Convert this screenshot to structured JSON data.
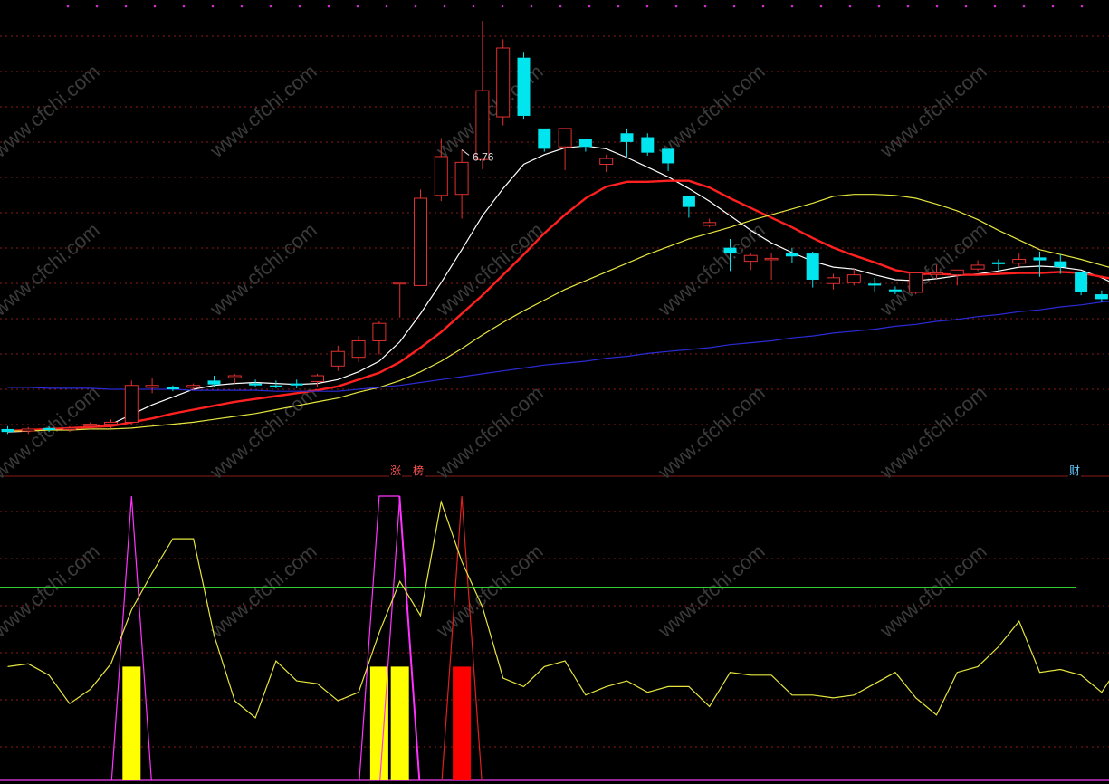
{
  "chart_data": [
    {
      "type": "candlestick",
      "title": "",
      "annotations": [
        {
          "text": "6.76",
          "bar": 22
        }
      ],
      "ylim": [
        2.4,
        6.9
      ],
      "candles": [
        [
          2.55,
          2.58,
          2.5,
          2.52
        ],
        [
          2.53,
          2.57,
          2.5,
          2.55
        ],
        [
          2.56,
          2.58,
          2.52,
          2.54
        ],
        [
          2.55,
          2.58,
          2.52,
          2.56
        ],
        [
          2.58,
          2.62,
          2.55,
          2.6
        ],
        [
          2.6,
          2.65,
          2.56,
          2.62
        ],
        [
          2.62,
          3.05,
          2.6,
          3.0
        ],
        [
          2.98,
          3.08,
          2.92,
          3.0
        ],
        [
          2.98,
          3.0,
          2.94,
          2.96
        ],
        [
          2.98,
          3.02,
          2.95,
          3.0
        ],
        [
          3.05,
          3.1,
          2.98,
          3.01
        ],
        [
          3.08,
          3.12,
          3.02,
          3.1
        ],
        [
          3.02,
          3.06,
          2.98,
          3.0
        ],
        [
          3.0,
          3.05,
          2.97,
          2.98
        ],
        [
          3.02,
          3.06,
          2.97,
          3.0
        ],
        [
          3.04,
          3.12,
          2.98,
          3.1
        ],
        [
          3.2,
          3.41,
          3.15,
          3.35
        ],
        [
          3.29,
          3.51,
          3.24,
          3.46
        ],
        [
          3.46,
          3.66,
          3.32,
          3.64
        ],
        [
          4.06,
          4.06,
          3.7,
          4.06
        ],
        [
          4.03,
          5.02,
          4.03,
          4.93
        ],
        [
          4.96,
          5.55,
          4.9,
          5.36
        ],
        [
          4.97,
          5.43,
          4.72,
          5.3
        ],
        [
          5.33,
          6.76,
          5.23,
          6.04
        ],
        [
          5.77,
          6.57,
          5.68,
          6.48
        ],
        [
          6.38,
          6.44,
          5.75,
          5.78
        ],
        [
          5.65,
          5.65,
          5.41,
          5.44
        ],
        [
          5.46,
          5.65,
          5.22,
          5.65
        ],
        [
          5.54,
          5.54,
          5.41,
          5.46
        ],
        [
          5.28,
          5.38,
          5.2,
          5.34
        ],
        [
          5.6,
          5.65,
          5.36,
          5.51
        ],
        [
          5.56,
          5.6,
          5.37,
          5.4
        ],
        [
          5.44,
          5.44,
          5.21,
          5.29
        ],
        [
          4.95,
          4.95,
          4.73,
          4.84
        ],
        [
          4.65,
          4.72,
          4.63,
          4.68
        ],
        [
          4.42,
          4.51,
          4.18,
          4.36
        ],
        [
          4.28,
          4.36,
          4.19,
          4.34
        ],
        [
          4.31,
          4.36,
          4.09,
          4.31
        ],
        [
          4.36,
          4.42,
          4.26,
          4.33
        ],
        [
          4.36,
          4.38,
          4.01,
          4.09
        ],
        [
          4.05,
          4.15,
          3.99,
          4.11
        ],
        [
          4.06,
          4.2,
          4.03,
          4.14
        ],
        [
          4.05,
          4.11,
          3.97,
          4.03
        ],
        [
          3.99,
          4.02,
          3.94,
          3.97
        ],
        [
          3.96,
          4.17,
          3.94,
          4.16
        ],
        [
          4.16,
          4.24,
          4.1,
          4.16
        ],
        [
          4.14,
          4.19,
          4.03,
          4.19
        ],
        [
          4.2,
          4.29,
          4.18,
          4.24
        ],
        [
          4.27,
          4.3,
          4.18,
          4.25
        ],
        [
          4.26,
          4.36,
          4.22,
          4.3
        ],
        [
          4.32,
          4.38,
          4.12,
          4.29
        ],
        [
          4.28,
          4.35,
          4.15,
          4.22
        ],
        [
          4.17,
          4.17,
          3.93,
          3.96
        ],
        [
          3.94,
          3.98,
          3.86,
          3.89
        ],
        [
          3.87,
          3.88,
          3.43,
          3.84
        ],
        [
          3.95,
          4.36,
          3.95,
          4.28
        ]
      ],
      "series": [
        {
          "name": "",
          "color": "#ffffff",
          "values": [
            2.52,
            2.53,
            2.55,
            2.55,
            2.57,
            2.6,
            2.7,
            2.8,
            2.88,
            2.96,
            3.0,
            3.02,
            3.03,
            3.02,
            3.01,
            3.02,
            3.06,
            3.14,
            3.25,
            3.45,
            3.74,
            4.06,
            4.4,
            4.75,
            5.03,
            5.28,
            5.38,
            5.45,
            5.47,
            5.44,
            5.35,
            5.25,
            5.15,
            5.03,
            4.9,
            4.75,
            4.6,
            4.47,
            4.37,
            4.28,
            4.22,
            4.2,
            4.14,
            4.09,
            4.08,
            4.1,
            4.13,
            4.15,
            4.18,
            4.22,
            4.23,
            4.22,
            4.19,
            4.11,
            4.01,
            4.0
          ]
        },
        {
          "name": "",
          "color": "#ff2020",
          "values": [
            2.53,
            2.54,
            2.55,
            2.56,
            2.57,
            2.58,
            2.62,
            2.66,
            2.71,
            2.75,
            2.79,
            2.83,
            2.86,
            2.89,
            2.92,
            2.95,
            2.99,
            3.06,
            3.13,
            3.24,
            3.39,
            3.55,
            3.74,
            3.93,
            4.14,
            4.35,
            4.57,
            4.76,
            4.93,
            5.05,
            5.1,
            5.1,
            5.11,
            5.11,
            5.04,
            4.93,
            4.83,
            4.73,
            4.63,
            4.52,
            4.42,
            4.34,
            4.27,
            4.19,
            4.15,
            4.15,
            4.14,
            4.14,
            4.15,
            4.16,
            4.16,
            4.17,
            4.16,
            4.12,
            4.08,
            4.08
          ]
        },
        {
          "name": "",
          "color": "#e6e640",
          "values": [
            2.53,
            2.53,
            2.54,
            2.54,
            2.55,
            2.55,
            2.56,
            2.58,
            2.6,
            2.62,
            2.65,
            2.68,
            2.71,
            2.75,
            2.79,
            2.83,
            2.87,
            2.93,
            2.98,
            3.05,
            3.14,
            3.25,
            3.38,
            3.52,
            3.65,
            3.77,
            3.88,
            3.99,
            4.08,
            4.17,
            4.26,
            4.35,
            4.43,
            4.51,
            4.57,
            4.63,
            4.7,
            4.76,
            4.82,
            4.88,
            4.95,
            4.97,
            4.97,
            4.96,
            4.93,
            4.87,
            4.8,
            4.71,
            4.6,
            4.5,
            4.4,
            4.35,
            4.3,
            4.24,
            4.18,
            4.14
          ]
        },
        {
          "name": "",
          "color": "#2b2bd8",
          "values": [
            2.98,
            2.98,
            2.97,
            2.97,
            2.97,
            2.96,
            2.96,
            2.96,
            2.96,
            2.95,
            2.95,
            2.95,
            2.95,
            2.94,
            2.94,
            2.94,
            2.94,
            2.96,
            2.98,
            3.0,
            3.03,
            3.06,
            3.09,
            3.12,
            3.15,
            3.18,
            3.21,
            3.23,
            3.25,
            3.28,
            3.3,
            3.33,
            3.35,
            3.37,
            3.39,
            3.42,
            3.44,
            3.46,
            3.49,
            3.51,
            3.54,
            3.56,
            3.58,
            3.61,
            3.63,
            3.66,
            3.68,
            3.71,
            3.73,
            3.76,
            3.78,
            3.81,
            3.83,
            3.86,
            3.88,
            3.91
          ]
        }
      ]
    },
    {
      "type": "indicator",
      "tags": [
        "涨",
        "榜",
        "财"
      ],
      "ylim": [
        0,
        100
      ],
      "level": 68,
      "line": {
        "color": "#e6e640",
        "values": [
          40,
          41,
          37,
          27,
          32,
          41,
          60,
          73,
          85,
          85,
          51,
          28,
          22,
          42,
          35,
          34,
          28,
          31,
          52,
          70,
          58,
          98,
          77,
          61,
          36,
          33,
          40,
          42,
          30,
          33,
          35,
          31,
          33,
          33,
          26,
          38,
          37,
          37,
          30,
          30,
          29,
          30,
          34,
          38,
          29,
          23,
          38,
          40,
          47,
          56,
          38,
          39,
          37,
          31,
          42,
          53
        ]
      },
      "bars": [
        {
          "bar": 6,
          "value": 40,
          "color": "#ffff00"
        },
        {
          "bar": 18,
          "value": 40,
          "color": "#ffff00"
        },
        {
          "bar": 19,
          "value": 40,
          "color": "#ffff00"
        },
        {
          "bar": 22,
          "value": 40,
          "color": "#ff0000"
        }
      ],
      "spikes": [
        {
          "bar": 6,
          "value": 100,
          "color": "#ff33ff"
        },
        {
          "bar": 18,
          "value": 100,
          "color": "#ff33ff",
          "flat": true
        },
        {
          "bar": 19,
          "value": 100,
          "color": "#ff33ff"
        },
        {
          "bar": 22,
          "value": 100,
          "color": "#e02020"
        }
      ]
    }
  ],
  "watermark": "www.cfchi.com",
  "colors": {
    "up": "#e03030",
    "down": "#00e5ee",
    "grid": "#8b1a1a",
    "divider": "#8b1a1a",
    "level": "#33cc33",
    "tag_up": "#ff5555",
    "tag_cai": "#66ccff",
    "dots": "#cc33cc"
  }
}
